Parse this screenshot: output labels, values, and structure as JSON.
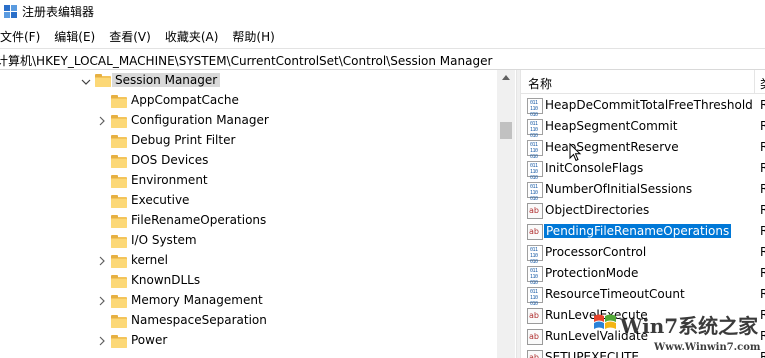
{
  "window": {
    "title": "注册表编辑器"
  },
  "menu": {
    "items": [
      {
        "label": "文件(F)"
      },
      {
        "label": "编辑(E)"
      },
      {
        "label": "查看(V)"
      },
      {
        "label": "收藏夹(A)"
      },
      {
        "label": "帮助(H)"
      }
    ]
  },
  "address": {
    "path": "计算机\\HKEY_LOCAL_MACHINE\\SYSTEM\\CurrentControlSet\\Control\\Session Manager"
  },
  "tree": {
    "selected": "Session Manager",
    "children": [
      {
        "label": "AppCompatCache",
        "expandable": false
      },
      {
        "label": "Configuration Manager",
        "expandable": true
      },
      {
        "label": "Debug Print Filter",
        "expandable": false
      },
      {
        "label": "DOS Devices",
        "expandable": false
      },
      {
        "label": "Environment",
        "expandable": false
      },
      {
        "label": "Executive",
        "expandable": false
      },
      {
        "label": "FileRenameOperations",
        "expandable": false
      },
      {
        "label": "I/O System",
        "expandable": false
      },
      {
        "label": "kernel",
        "expandable": true
      },
      {
        "label": "KnownDLLs",
        "expandable": false
      },
      {
        "label": "Memory Management",
        "expandable": true
      },
      {
        "label": "NamespaceSeparation",
        "expandable": false
      },
      {
        "label": "Power",
        "expandable": true
      }
    ]
  },
  "list": {
    "column_name": "名称",
    "column_type": "类",
    "selected": "PendingFileRenameOperations",
    "rows": [
      {
        "name": "HeapDeCommitTotalFreeThreshold",
        "icon": "binary",
        "type": "R"
      },
      {
        "name": "HeapSegmentCommit",
        "icon": "binary",
        "type": "R"
      },
      {
        "name": "HeapSegmentReserve",
        "icon": "binary",
        "type": "R"
      },
      {
        "name": "InitConsoleFlags",
        "icon": "binary",
        "type": "R"
      },
      {
        "name": "NumberOfInitialSessions",
        "icon": "binary",
        "type": "R"
      },
      {
        "name": "ObjectDirectories",
        "icon": "string",
        "type": "R"
      },
      {
        "name": "PendingFileRenameOperations",
        "icon": "string",
        "type": "R"
      },
      {
        "name": "ProcessorControl",
        "icon": "binary",
        "type": "R"
      },
      {
        "name": "ProtectionMode",
        "icon": "binary",
        "type": "R"
      },
      {
        "name": "ResourceTimeoutCount",
        "icon": "binary",
        "type": "R"
      },
      {
        "name": "RunLevelExecute",
        "icon": "string",
        "type": "R"
      },
      {
        "name": "RunLevelValidate",
        "icon": "string",
        "type": "R"
      },
      {
        "name": "SETUPEXECUTE",
        "icon": "string",
        "type": "R"
      }
    ]
  },
  "watermark": {
    "logo": "Win7系统之家",
    "url": "Www.Winwin7.com"
  },
  "colors": {
    "selection": "#0078d7",
    "tree_selection": "#d9d9d9",
    "folder": "#fcd877"
  }
}
